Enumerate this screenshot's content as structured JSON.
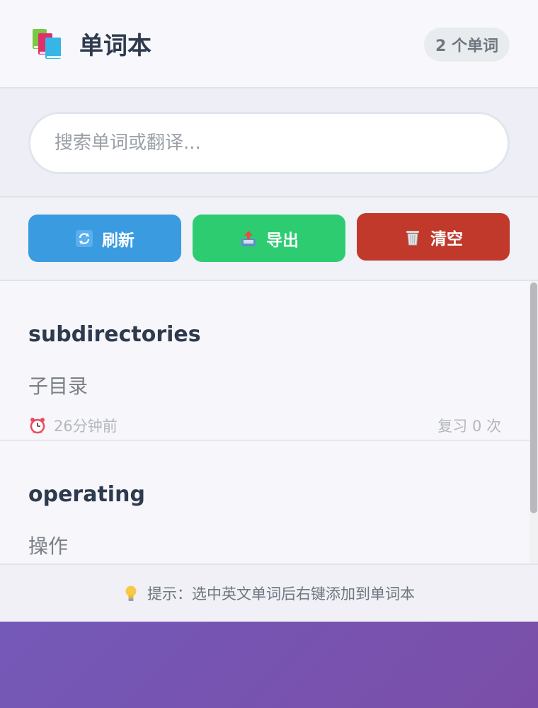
{
  "header": {
    "title": "单词本",
    "word_count": "2 个单词",
    "logo_icon": "books-icon"
  },
  "search": {
    "placeholder": "搜索单词或翻译...",
    "value": ""
  },
  "toolbar": {
    "refresh_label": "刷新",
    "export_label": "导出",
    "clear_label": "清空",
    "refresh_color": "#3a9be0",
    "export_color": "#2ecc71",
    "clear_color": "#c0392b"
  },
  "words": [
    {
      "english": "subdirectories",
      "chinese": "子目录",
      "time": "26分钟前",
      "review": "复习 0 次"
    },
    {
      "english": "operating",
      "chinese": "操作"
    }
  ],
  "footer": {
    "tip": "提示：选中英文单词后右键添加到单词本"
  }
}
